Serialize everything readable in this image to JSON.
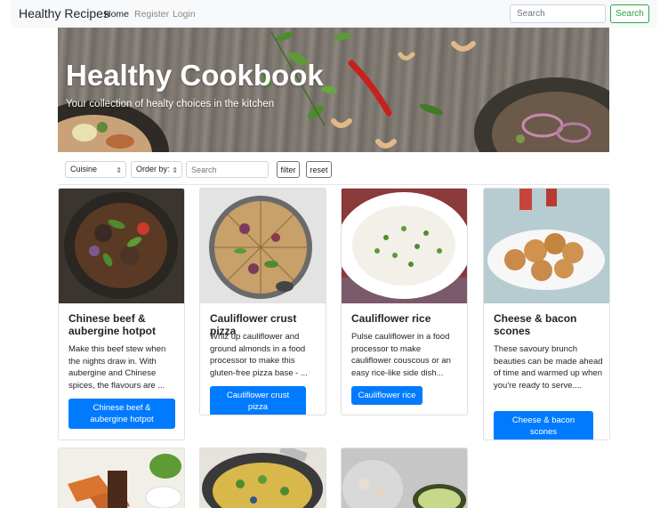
{
  "navbar": {
    "brand": "Healthy Recipes",
    "links": [
      {
        "label": "Home",
        "active": true
      },
      {
        "label": "Register",
        "active": false
      },
      {
        "label": "Login",
        "active": false
      }
    ],
    "search_placeholder": "Search",
    "search_button": "Search"
  },
  "hero": {
    "title": "Healthy Cookbook",
    "subtitle": "Your collection of healty choices in the kitchen"
  },
  "filters": {
    "cuisine_selected": "Cuisine",
    "order_selected": "Order by:",
    "search_placeholder": "Search",
    "filter_button": "filter",
    "reset_button": "reset"
  },
  "recipes": [
    {
      "title": "Chinese beef & aubergine hotpot",
      "description": "Make this beef stew when the nights draw in. With aubergine and Chinese spices, the flavours are ...",
      "button": "Chinese beef & aubergine hotpot"
    },
    {
      "title": "Cauliflower crust pizza",
      "description": "Whiz up cauliflower and ground almonds in a food processor to make this gluten-free pizza base - ...",
      "button": "Cauliflower crust pizza"
    },
    {
      "title": "Cauliflower rice",
      "description": "Pulse cauliflower in a food processor to make cauliflower couscous or an easy rice-like side dish...",
      "button": "Cauliflower rice"
    },
    {
      "title": "Cheese & bacon scones",
      "description": "These savoury brunch beauties can be made ahead of time and warmed up when you're ready to serve....",
      "button": "Cheese & bacon scones"
    }
  ],
  "colors": {
    "primary": "#007bff",
    "success": "#28a745",
    "navbar_bg": "#f8f9fa"
  }
}
